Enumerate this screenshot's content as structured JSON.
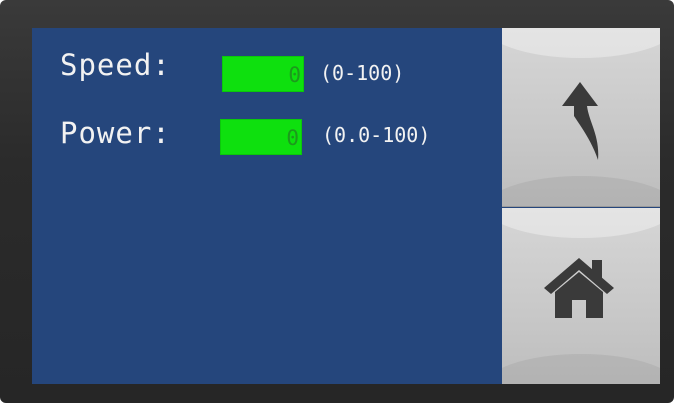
{
  "form": {
    "speed": {
      "label": "Speed:",
      "value": "0",
      "range": "(0-100)"
    },
    "power": {
      "label": "Power:",
      "value": "0",
      "range": "(0.0-100)"
    }
  },
  "side_buttons": [
    {
      "icon": "back-arrow-icon"
    },
    {
      "icon": "home-icon"
    }
  ],
  "colors": {
    "screen_background": "#25467c",
    "value_box": "#0ee00e",
    "button": "#d0d0d0",
    "bezel": "#2b2b2b",
    "icon": "#3a3a3a"
  }
}
